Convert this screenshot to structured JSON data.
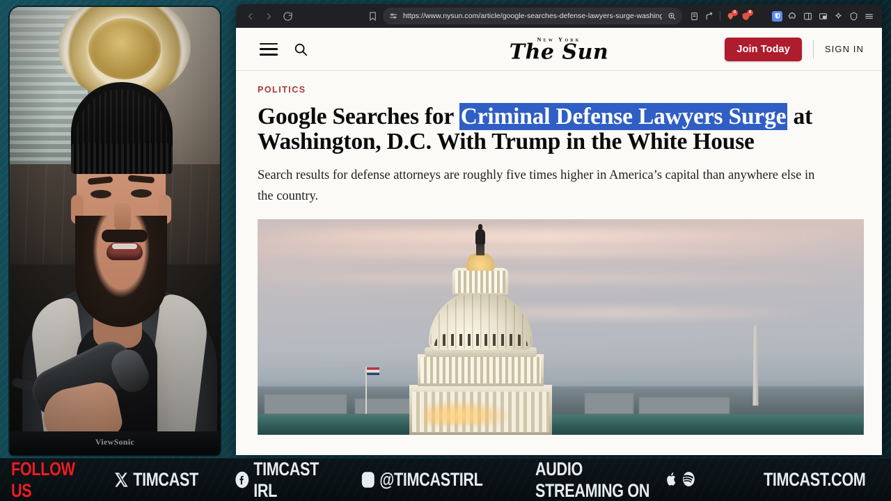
{
  "browser": {
    "url": "https://www.nysun.com/article/google-searches-defense-lawyers-surge-washington-trump-white-h...",
    "nav": {
      "back": "back-arrow",
      "forward": "forward-arrow",
      "reload": "reload-icon",
      "bookmark": "bookmark-icon",
      "site_settings": "tune-icon",
      "zoom": "zoom-icon"
    },
    "extensions": [
      {
        "name": "reader-mode-icon",
        "badge": ""
      },
      {
        "name": "share-icon",
        "badge": ""
      },
      {
        "name": "adblock-icon",
        "badge": "0"
      },
      {
        "name": "shield-alert-icon",
        "badge": "8"
      }
    ],
    "right_icons": [
      {
        "name": "bitwarden-icon"
      },
      {
        "name": "puzzle-extensions-icon"
      },
      {
        "name": "sidebar-icon"
      },
      {
        "name": "picture-in-picture-icon"
      },
      {
        "name": "sparkle-ai-icon"
      },
      {
        "name": "shield-privacy-icon"
      },
      {
        "name": "menu-icon"
      }
    ]
  },
  "site": {
    "masthead_kicker": "New York",
    "masthead_name": "The Sun",
    "join_label": "Join Today",
    "signin_label": "SIGN IN",
    "accent_red": "#af1c2e"
  },
  "article": {
    "kicker": "POLITICS",
    "kicker_color": "#a63b36",
    "headline_pre": "Google Searches for ",
    "headline_selected": "Criminal Defense Lawyers Surge",
    "headline_post": " at Washington, D.C. With Trump in the White House",
    "selection_color": "#2f5fc4",
    "dek": "Search results for defense attorneys are roughly five times higher in America’s capital than anywhere else in the country.",
    "hero_alt": "United States Capitol dome at dusk with the Washington Monument in the distance"
  },
  "webcam": {
    "monitor_brand": "ViewSonic"
  },
  "banner": {
    "follow_label": "FOLLOW US",
    "follow_color": "#ef1b20",
    "x_handle": "TIMCAST",
    "facebook_handle": "TIMCAST IRL",
    "instagram_handle": "@TIMCASTIRL",
    "audio_label": "AUDIO STREAMING ON",
    "website": "TIMCAST.COM"
  }
}
